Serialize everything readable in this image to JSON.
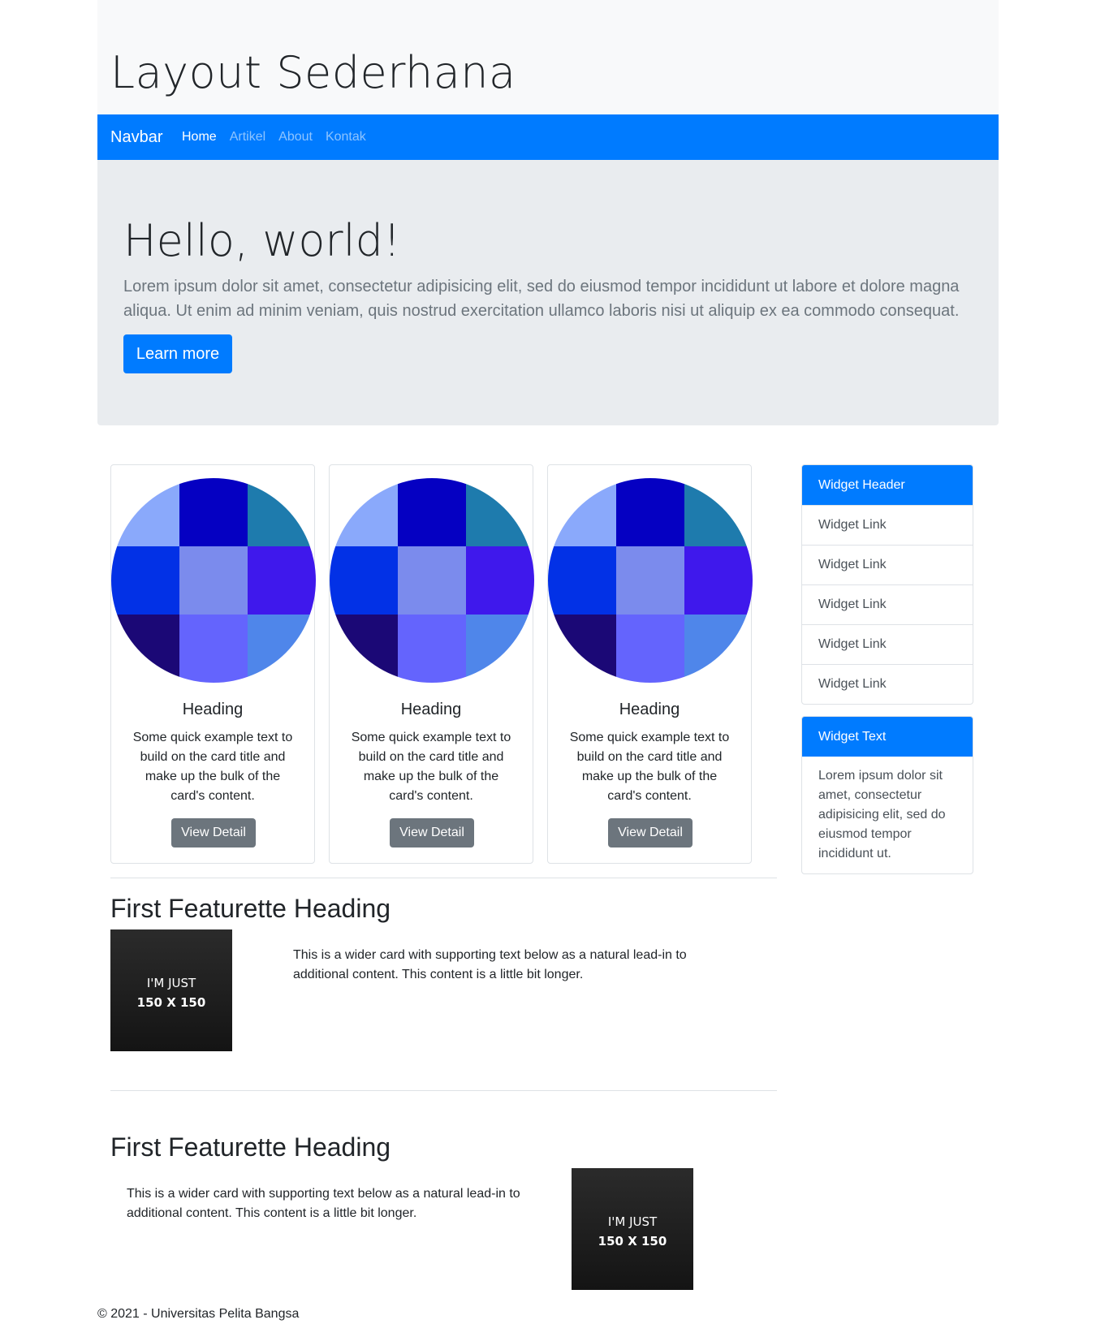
{
  "header": {
    "title": "Layout Sederhana"
  },
  "navbar": {
    "brand": "Navbar",
    "links": [
      "Home",
      "Artikel",
      "About",
      "Kontak"
    ]
  },
  "jumbotron": {
    "title": "Hello, world!",
    "text": "Lorem ipsum dolor sit amet, consectetur adipisicing elit, sed do eiusmod tempor incididunt ut labore et dolore magna aliqua. Ut enim ad minim veniam, quis nostrud exercitation ullamco laboris nisi ut aliquip ex ea commodo consequat.",
    "button": "Learn more"
  },
  "cards": [
    {
      "title": "Heading",
      "text": "Some quick example text to build on the card title and make up the bulk of the card's content.",
      "button": "View Detail"
    },
    {
      "title": "Heading",
      "text": "Some quick example text to build on the card title and make up the bulk of the card's content.",
      "button": "View Detail"
    },
    {
      "title": "Heading",
      "text": "Some quick example text to build on the card title and make up the bulk of the card's content.",
      "button": "View Detail"
    }
  ],
  "card_image_colors": [
    "#8aa9fb",
    "#0500c2",
    "#1e7bad",
    "#0231e6",
    "#7b8bed",
    "#3f18ec",
    "#1b0876",
    "#6464fd",
    "#4f86ea"
  ],
  "sidebar": {
    "widget_header": "Widget Header",
    "links": [
      "Widget Link",
      "Widget Link",
      "Widget Link",
      "Widget Link",
      "Widget Link"
    ],
    "text_header": "Widget Text",
    "text_body": "Lorem ipsum dolor sit amet, consectetur adipisicing elit, sed do eiusmod tempor incididunt ut."
  },
  "featurettes": [
    {
      "heading": "First Featurette Heading",
      "text": "This is a wider card with supporting text below as a natural lead-in to additional content. This content is a little bit longer.",
      "image_line1": "I'M JUST",
      "image_line2": "150 X 150"
    },
    {
      "heading": "First Featurette Heading",
      "text": "This is a wider card with supporting text below as a natural lead-in to additional content. This content is a little bit longer.",
      "image_line1": "I'M JUST",
      "image_line2": "150 X 150"
    }
  ],
  "footer": {
    "text": "© 2021 - Universitas Pelita Bangsa"
  },
  "colors": {
    "primary": "#007bff",
    "secondary": "#6c757d",
    "jumbotron_bg": "#e9ecef",
    "header_bg": "#f8f9fa"
  }
}
